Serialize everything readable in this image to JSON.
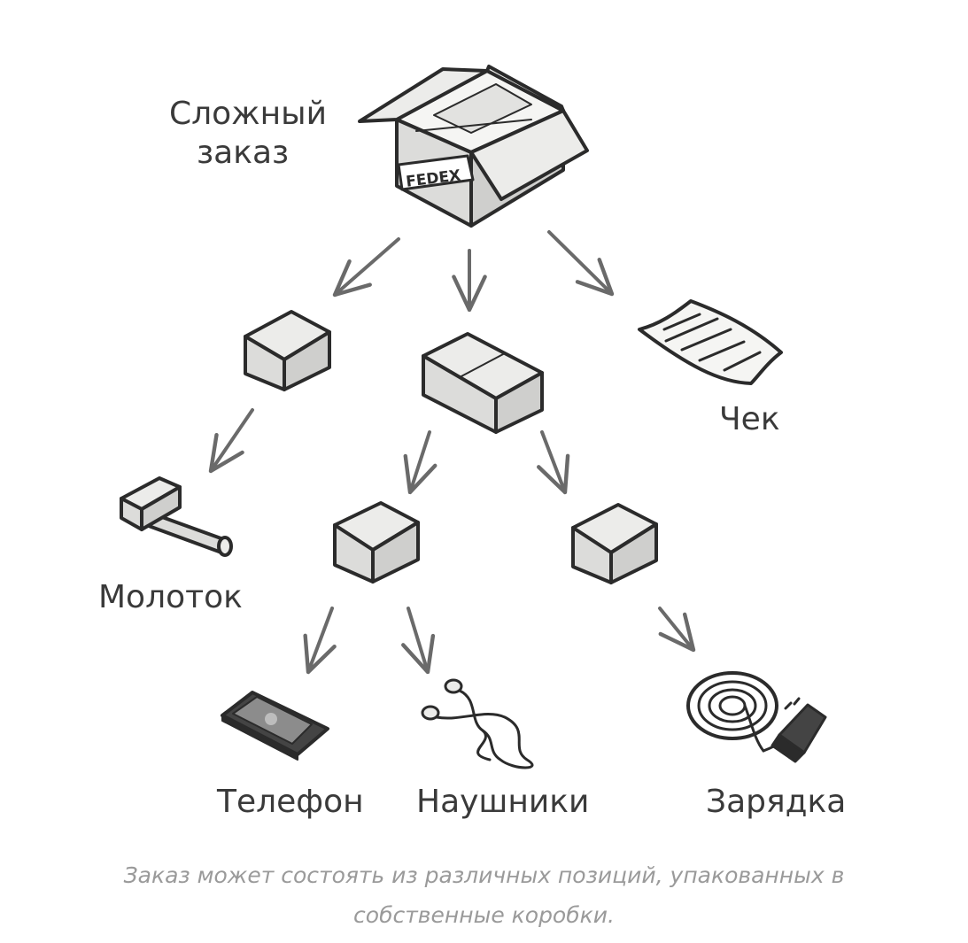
{
  "labels": {
    "complex_order_line1": "Сложный",
    "complex_order_line2": "заказ",
    "receipt": "Чек",
    "hammer": "Молоток",
    "phone": "Телефон",
    "headphones": "Наушники",
    "charger": "Зарядка",
    "fedex_tag": "FEDEX"
  },
  "caption": {
    "line1": "Заказ может состоять из различных позиций, упакованных в",
    "line2": "собственные коробки."
  },
  "colors": {
    "box_top": "#ececea",
    "box_left": "#dcdcda",
    "box_right": "#cfcfcd",
    "outline": "#2b2b2b",
    "arrow": "#6a6a6a",
    "label": "#3a3a3a",
    "caption": "#9a9a9a"
  },
  "icons": [
    "open-box-icon",
    "box-icon",
    "receipt-icon",
    "hammer-icon",
    "phone-icon",
    "headphones-icon",
    "charger-icon"
  ]
}
